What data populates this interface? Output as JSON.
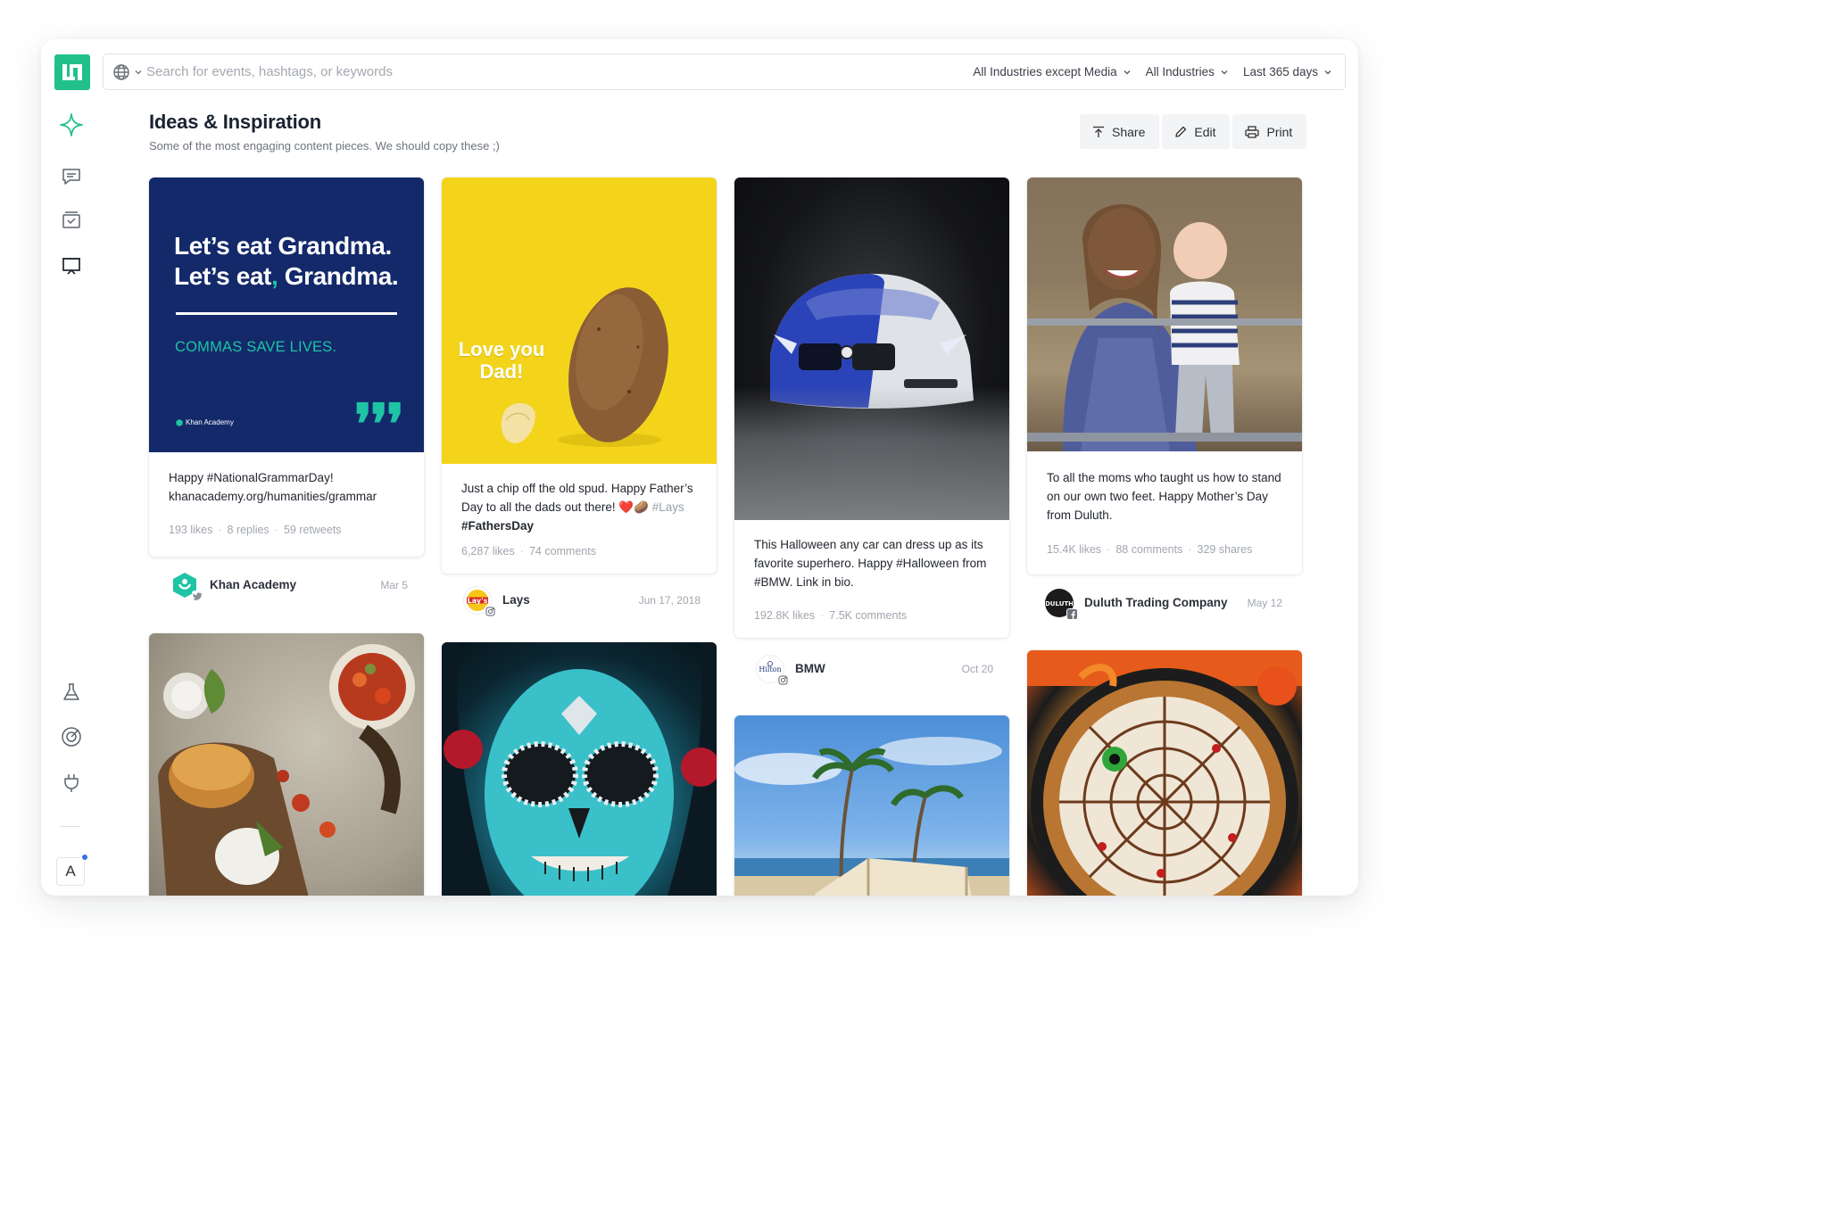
{
  "app": {
    "logo_icon": "social-logo-icon",
    "accent_color": "#21c08b"
  },
  "search": {
    "placeholder": "Search for events, hashtags, or keywords",
    "value": "",
    "filters": [
      {
        "label": "All Industries except Media"
      },
      {
        "label": "All Industries"
      },
      {
        "label": "Last 365 days"
      }
    ]
  },
  "sidebar": {
    "items": [
      {
        "name": "sparkle-icon",
        "active": true
      },
      {
        "name": "chat-icon"
      },
      {
        "name": "inbox-check-icon"
      },
      {
        "name": "presentation-board-icon"
      },
      {
        "name": "flask-icon"
      },
      {
        "name": "target-icon"
      },
      {
        "name": "plug-icon"
      }
    ],
    "account_initial": "A"
  },
  "header": {
    "title": "Ideas & Inspiration",
    "subtitle": "Some of the most engaging content pieces. We should copy these ;)",
    "actions": [
      {
        "label": "Share",
        "icon": "upload-icon"
      },
      {
        "label": "Edit",
        "icon": "pencil-icon"
      },
      {
        "label": "Print",
        "icon": "printer-icon"
      }
    ]
  },
  "cards": [
    {
      "image": {
        "headline_line1": "Let’s eat Grandma.",
        "headline_line2a": "Let’s eat",
        "headline_comma": ",",
        "headline_line2b": " Grandma.",
        "subline": "COMMAS SAVE LIVES.",
        "brand": "Khan Academy",
        "quote_marks": "❜❜❜"
      },
      "caption_line1": "Happy #NationalGrammarDay!",
      "caption_line2": "khanacademy.org/humanities/grammar",
      "stats": [
        "193 likes",
        "8 replies",
        "59 retweets"
      ],
      "author": "Khan Academy",
      "platform": "twitter",
      "date": "Mar 5"
    },
    {
      "image": {
        "text_line1": "Love you",
        "text_line2": "Dad!"
      },
      "caption": "Just a chip off the old spud. Happy Father’s Day to all the dads out there! ❤️🥔",
      "caption_tag": "#Lays",
      "caption_bold_tag": "#FathersDay",
      "stats": [
        "6,287 likes",
        "74 comments"
      ],
      "author": "Lays",
      "platform": "instagram",
      "date": "Jun 17, 2018"
    },
    {
      "caption": "This Halloween any car can dress up as its favorite superhero. Happy #Halloween from #BMW. Link in bio.",
      "stats": [
        "192.8K likes",
        "7.5K comments"
      ],
      "author": "BMW",
      "author_logo_text": "Hilton",
      "platform": "instagram",
      "date": "Oct 20"
    },
    {
      "caption": "To all the moms who taught us how to stand on our own two feet. Happy Mother’s Day from Duluth.",
      "stats": [
        "15.4K likes",
        "88 comments",
        "329 shares"
      ],
      "author": "Duluth Trading Company",
      "author_logo_text": "DULUTH",
      "platform": "facebook",
      "date": "May 12"
    }
  ]
}
